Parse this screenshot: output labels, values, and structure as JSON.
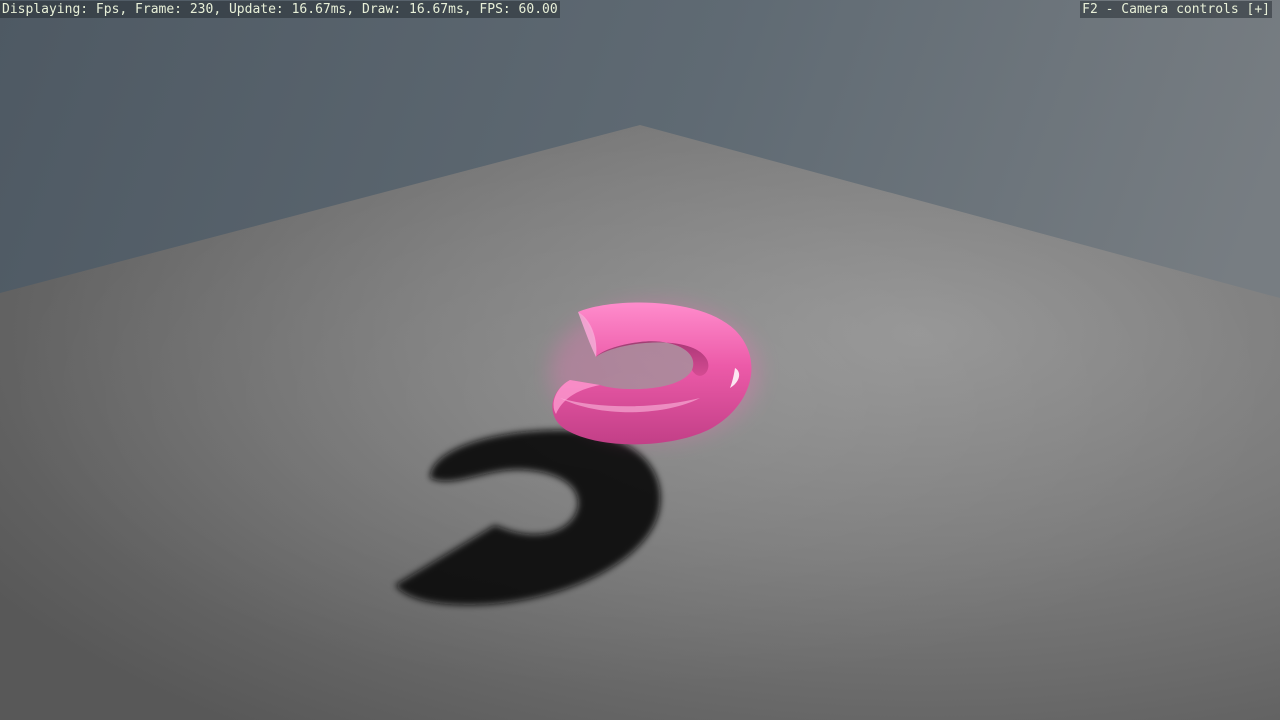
{
  "hud": {
    "stats_text": "Displaying: Fps, Frame: 230, Update: 16.67ms, Draw: 16.67ms, FPS: 60.00",
    "camera_controls_text": "F2 - Camera controls [+]"
  },
  "scene": {
    "colors": {
      "sky_left": "#4f5a63",
      "sky_right": "#6e767c",
      "floor_light": "#8e8e8e",
      "floor_dark": "#5c5c5c",
      "torus": "#ea5aa6",
      "shadow": "#0a0a0a",
      "hud_text": "#e8f0d8"
    },
    "objects": [
      "ground-plane",
      "pink-torus",
      "torus-shadow"
    ]
  }
}
